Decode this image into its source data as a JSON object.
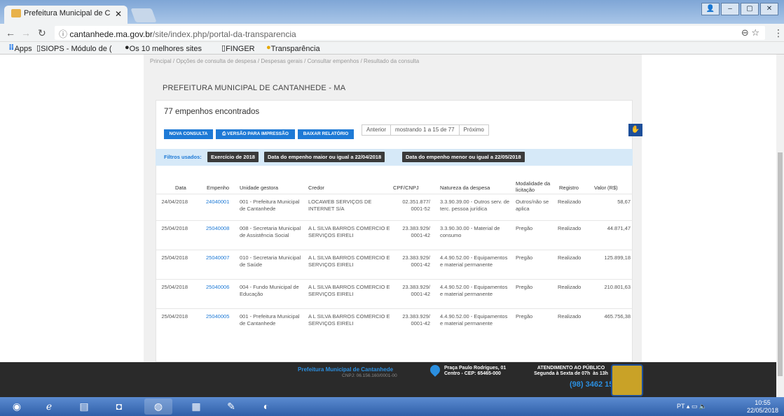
{
  "browser": {
    "tab_title": "Prefeitura Municipal de C",
    "url_host": "cantanhede.ma.gov.br",
    "url_path": "/site/index.php/portal-da-transparencia",
    "bookmarks": [
      "Apps",
      "SIOPS - Módulo de (",
      "Os 10 melhores sites",
      "FINGER",
      "Transparência"
    ]
  },
  "breadcrumb": "Principal  /  Opções de consulta de despesa  /  Despesas gerais  /  Consultar empenhos  /  Resultado da consulta",
  "page_title": "PREFEITURA MUNICIPAL DE CANTANHEDE - MA",
  "found": "77 empenhos encontrados",
  "buttons": {
    "new": "NOVA CONSULTA",
    "print": "⎙ VERSÃO PARA IMPRESSÃO",
    "download": "BAIXAR RELATÓRIO"
  },
  "pager": {
    "prev": "Anterior",
    "info": "mostrando 1 a 15 de 77",
    "next": "Próximo"
  },
  "filters": {
    "label": "Filtros usados:",
    "chips": [
      "Exercício de 2018",
      "Data do empenho maior ou igual a 22/04/2018",
      "Data do empenho menor ou igual a 22/05/2018"
    ]
  },
  "table": {
    "headers": [
      "Data",
      "Empenho",
      "Unidade gestora",
      "Credor",
      "CPF/CNPJ",
      "Natureza da despesa",
      "Modalidade da licitação",
      "Registro",
      "Valor (R$)"
    ],
    "rows": [
      {
        "data": "24/04/2018",
        "empenho": "24040001",
        "unidade": "001 - Prefeitura Municipal de Cantanhede",
        "credor": "LOCAWEB SERVIÇOS DE INTERNET S/A",
        "cnpj": "02.351.877/ 0001-52",
        "natureza": "3.3.90.39.00 - Outros serv. de terc. pessoa jurídica",
        "modalidade": "Outros/não se aplica",
        "registro": "Realizado",
        "valor": "58,67"
      },
      {
        "data": "25/04/2018",
        "empenho": "25040008",
        "unidade": "008 - Secretaria Municipal de Assistência Social",
        "credor": "A L SILVA BARROS COMERCIO E SERVIÇOS EIRELI",
        "cnpj": "23.383.929/ 0001-42",
        "natureza": "3.3.90.30.00 - Material de consumo",
        "modalidade": "Pregão",
        "registro": "Realizado",
        "valor": "44.871,47"
      },
      {
        "data": "25/04/2018",
        "empenho": "25040007",
        "unidade": "010 - Secretaria Municipal de Saúde",
        "credor": "A L SILVA BARROS COMERCIO E SERVIÇOS EIRELI",
        "cnpj": "23.383.929/ 0001-42",
        "natureza": "4.4.90.52.00 - Equipamentos e material permanente",
        "modalidade": "Pregão",
        "registro": "Realizado",
        "valor": "125.899,18"
      },
      {
        "data": "25/04/2018",
        "empenho": "25040006",
        "unidade": "004 - Fundo Municipal de Educação",
        "credor": "A L SILVA BARROS COMERCIO E SERVIÇOS EIRELI",
        "cnpj": "23.383.929/ 0001-42",
        "natureza": "4.4.90.52.00 - Equipamentos e material permanente",
        "modalidade": "Pregão",
        "registro": "Realizado",
        "valor": "210.801,63"
      },
      {
        "data": "25/04/2018",
        "empenho": "25040005",
        "unidade": "001 - Prefeitura Municipal de Cantanhede",
        "credor": "A L SILVA BARROS COMERCIO E SERVIÇOS EIRELI",
        "cnpj": "23.383.929/ 0001-42",
        "natureza": "4.4.90.52.00 - Equipamentos e material permanente",
        "modalidade": "Pregão",
        "registro": "Realizado",
        "valor": "465.756,38"
      }
    ]
  },
  "footer": {
    "org": "Prefeitura Municipal de Cantanhede",
    "cnpj": "CNPJ: 06.156.160/0001-00",
    "address": "Praça Paulo Rodrigues, 01\nCentro - CEP: 65465-000",
    "attendance": "ATENDIMENTO AO PÚBLICO\nSegunda à Sexta de 07h  às 13h",
    "phone": "(98) 3462 1553"
  },
  "taskbar": {
    "lang": "PT",
    "time": "10:55",
    "date": "22/05/2018"
  }
}
